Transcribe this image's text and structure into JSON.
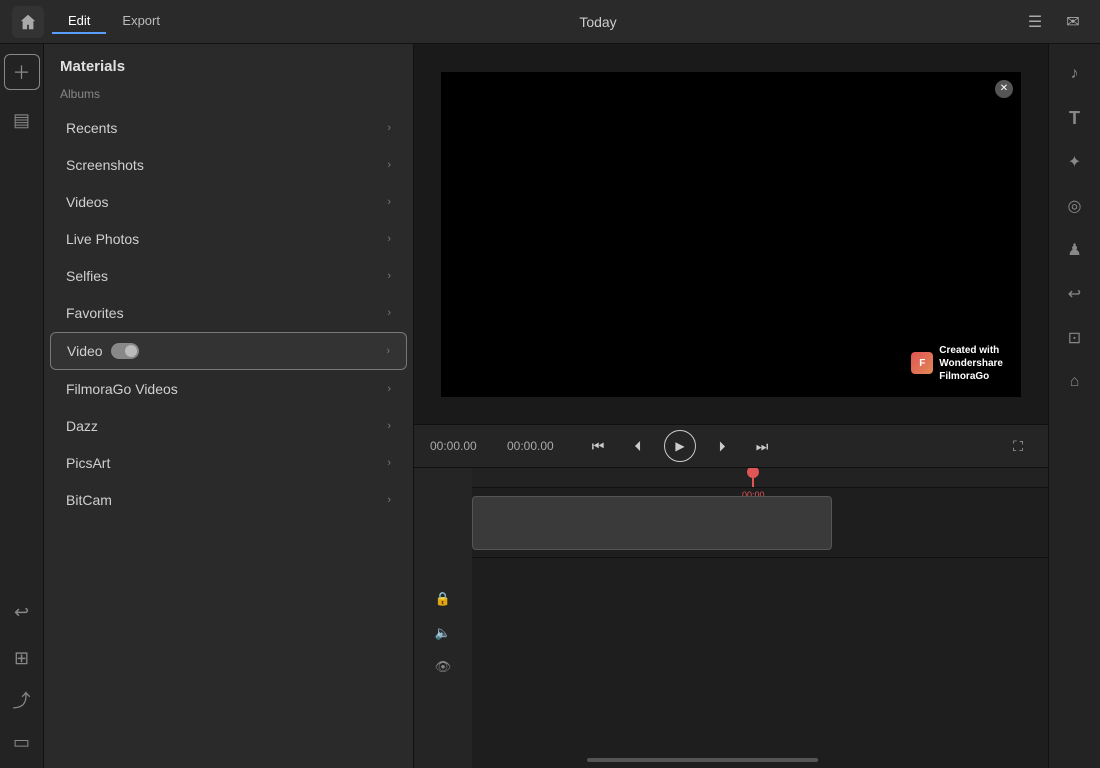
{
  "topBar": {
    "tabs": [
      {
        "id": "edit",
        "label": "Edit",
        "active": true
      },
      {
        "id": "export",
        "label": "Export",
        "active": false
      }
    ],
    "centerTitle": "Today",
    "icons": {
      "menu": "☰",
      "mail": "✉"
    }
  },
  "leftSidebar": {
    "items": [
      {
        "id": "add",
        "icon": "+",
        "isAdd": true
      },
      {
        "id": "layers",
        "icon": "▤"
      },
      {
        "id": "undo",
        "icon": "↩"
      },
      {
        "id": "grid",
        "icon": "⊞"
      },
      {
        "id": "share",
        "icon": "⤴"
      },
      {
        "id": "device",
        "icon": "▭"
      }
    ]
  },
  "mediaPanel": {
    "title": "Materials",
    "subtitle": "Albums",
    "items": [
      {
        "id": "recents",
        "label": "Recents",
        "hasChevron": true,
        "hasToggle": false,
        "selected": false
      },
      {
        "id": "screenshots",
        "label": "Screenshots",
        "hasChevron": true,
        "hasToggle": false,
        "selected": false
      },
      {
        "id": "videos",
        "label": "Videos",
        "hasChevron": true,
        "hasToggle": false,
        "selected": false
      },
      {
        "id": "livephotos",
        "label": "Live Photos",
        "hasChevron": true,
        "hasToggle": false,
        "selected": false
      },
      {
        "id": "selfies",
        "label": "Selfies",
        "hasChevron": true,
        "hasToggle": false,
        "selected": false
      },
      {
        "id": "favorites",
        "label": "Favorites",
        "hasChevron": true,
        "hasToggle": false,
        "selected": false
      },
      {
        "id": "video",
        "label": "Video",
        "hasChevron": true,
        "hasToggle": true,
        "selected": true
      },
      {
        "id": "filmoragovideos",
        "label": "FilmoraGo Videos",
        "hasChevron": true,
        "hasToggle": false,
        "selected": false
      },
      {
        "id": "dazz",
        "label": "Dazz",
        "hasChevron": true,
        "hasToggle": false,
        "selected": false
      },
      {
        "id": "picsart",
        "label": "PicsArt",
        "hasChevron": true,
        "hasToggle": false,
        "selected": false
      },
      {
        "id": "bitcam",
        "label": "BitCam",
        "hasChevron": true,
        "hasToggle": false,
        "selected": false
      }
    ]
  },
  "preview": {
    "watermark": {
      "created_with": "Created with",
      "brand": "Wondershare",
      "product": "FilmoraGo"
    }
  },
  "playback": {
    "time1": "00:00.00",
    "time2": "00:00.00",
    "timecode": "00:00"
  },
  "rightSidebar": {
    "icons": [
      {
        "id": "music",
        "unicode": "♪"
      },
      {
        "id": "text",
        "unicode": "T"
      },
      {
        "id": "sticker",
        "unicode": "✦"
      },
      {
        "id": "effect",
        "unicode": "◎"
      },
      {
        "id": "person",
        "unicode": "♟"
      },
      {
        "id": "undo2",
        "unicode": "↩"
      },
      {
        "id": "crop",
        "unicode": "⊡"
      },
      {
        "id": "headphones",
        "unicode": "⌂"
      }
    ]
  },
  "timeline": {
    "trackIcons": [
      {
        "id": "lock",
        "unicode": "🔒"
      },
      {
        "id": "audio",
        "unicode": "🔈"
      },
      {
        "id": "eye",
        "unicode": "👁"
      }
    ]
  }
}
